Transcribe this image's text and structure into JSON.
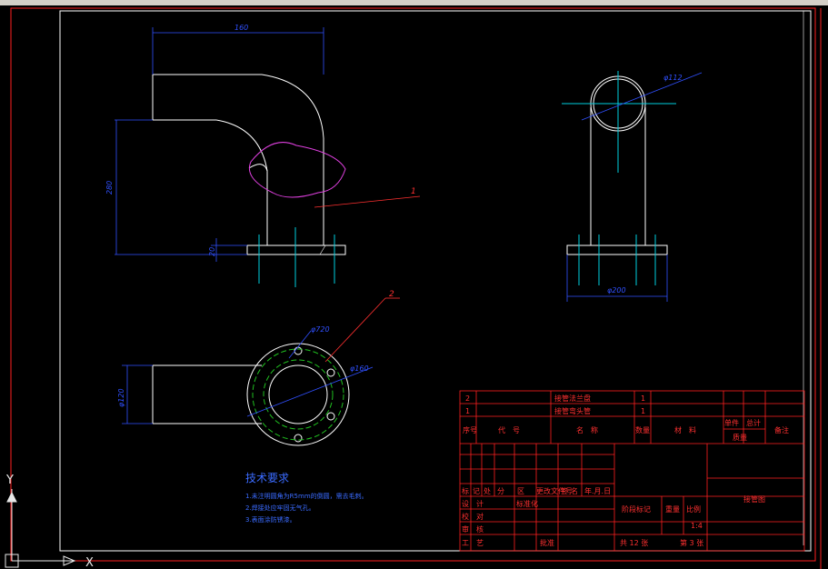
{
  "colors": {
    "background": "#000000",
    "outline": "#ffffff",
    "frame": "#ff2020",
    "dimension": "#3050ff",
    "centerline": "#00d0e0",
    "section": "#e040e0",
    "hidden": "#20c020"
  },
  "dimensions": {
    "top_width": "160",
    "height": "280",
    "flange_thick": "20",
    "side_dia": "φ112",
    "side_width": "φ200",
    "bottom_dia": "φ120",
    "bolt_circle": "φ160",
    "bolt_dia": "φ720"
  },
  "leaders": {
    "part1": "1",
    "part2": "2"
  },
  "tech_notes": {
    "title": "技术要求",
    "lines": [
      "1.未注明圆角为R5mm的倒圆，需去毛刺。",
      "2.焊接处应牢固无气孔。",
      "3.表面涂防锈漆。"
    ]
  },
  "title_block": {
    "parts": [
      {
        "no": "2",
        "name": "接管法兰盘",
        "qty": "1"
      },
      {
        "no": "1",
        "name": "接管弯头管",
        "qty": "1"
      }
    ],
    "hdr_no": "序号",
    "hdr_code": "代　号",
    "hdr_name": "名　称",
    "hdr_qty": "数量",
    "hdr_material": "材　料",
    "hdr_unit": "单件",
    "hdr_total": "总计",
    "hdr_weight": "质量",
    "hdr_remark": "备注",
    "rev_labels": [
      "标",
      "记",
      "处",
      "分",
      "区",
      "更改文件号",
      "签",
      "名",
      "年.月.日"
    ],
    "sign_rows": [
      "设　计",
      "校　对",
      "审　核",
      "工　艺"
    ],
    "std_label": "标准化",
    "approve_label": "批准",
    "stage_label": "阶段标记",
    "weight_label": "重量",
    "scale_label": "比例",
    "scale_value": "1:4",
    "sheets_total": "共 12 张",
    "sheet_no": "第 3 张",
    "drawing_name": "接管图"
  },
  "ucs": {
    "y": "Y",
    "x": "X"
  }
}
